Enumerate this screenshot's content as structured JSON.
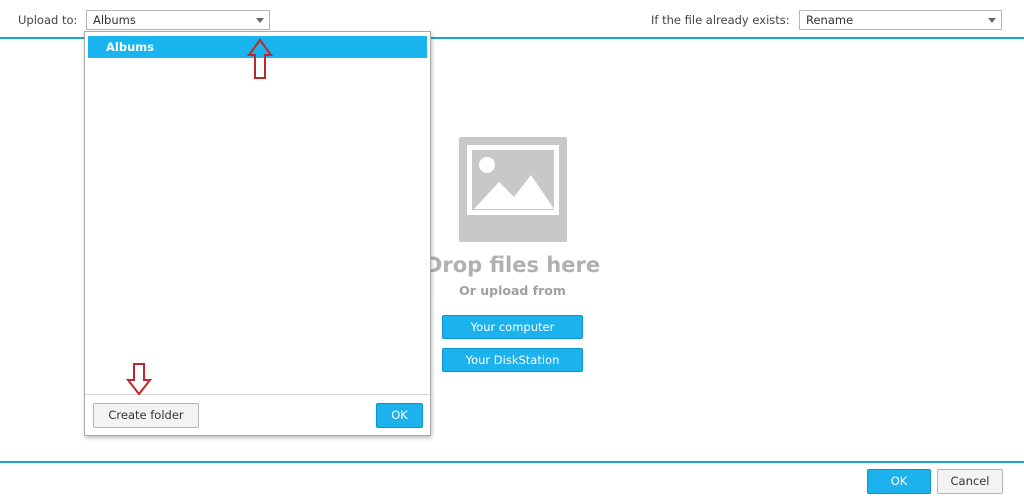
{
  "toolbar": {
    "upload_to_label": "Upload to:",
    "upload_to_value": "Albums",
    "exists_label": "If the file already exists:",
    "exists_value": "Rename"
  },
  "dropdown": {
    "items": [
      {
        "label": "Albums",
        "selected": true
      }
    ],
    "create_folder_label": "Create folder",
    "ok_label": "OK"
  },
  "dropzone": {
    "title": "Drop files here",
    "subtitle": "Or upload from",
    "computer_button": "Your computer",
    "diskstation_button": "Your DiskStation"
  },
  "footer": {
    "ok_label": "OK",
    "cancel_label": "Cancel"
  },
  "colors": {
    "accent": "#1ab4ee",
    "annotation_arrow": "#c0272d"
  }
}
